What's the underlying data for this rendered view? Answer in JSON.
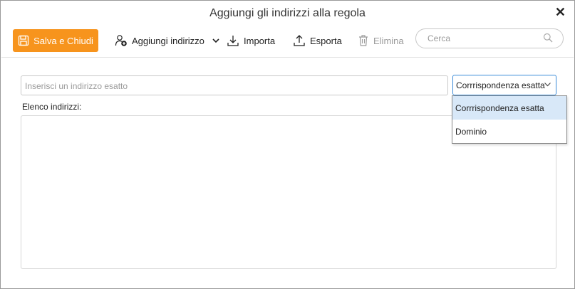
{
  "window": {
    "title": "Aggiungi gli indirizzi alla regola"
  },
  "toolbar": {
    "save_label": "Salva e Chiudi",
    "add_label": "Aggiungi indirizzo",
    "import_label": "Importa",
    "export_label": "Esporta",
    "delete_label": "Elimina",
    "search_placeholder": "Cerca"
  },
  "form": {
    "address_placeholder": "Inserisci un indirizzo esatto",
    "match_selected": "Corrrispondenza esatta",
    "match_options": [
      "Corrrispondenza esatta",
      "Dominio"
    ],
    "list_label": "Elenco indirizzi:"
  },
  "colors": {
    "accent": "#f7941d",
    "focus": "#3a8bd8",
    "selected_option": "#d8e8f8"
  }
}
